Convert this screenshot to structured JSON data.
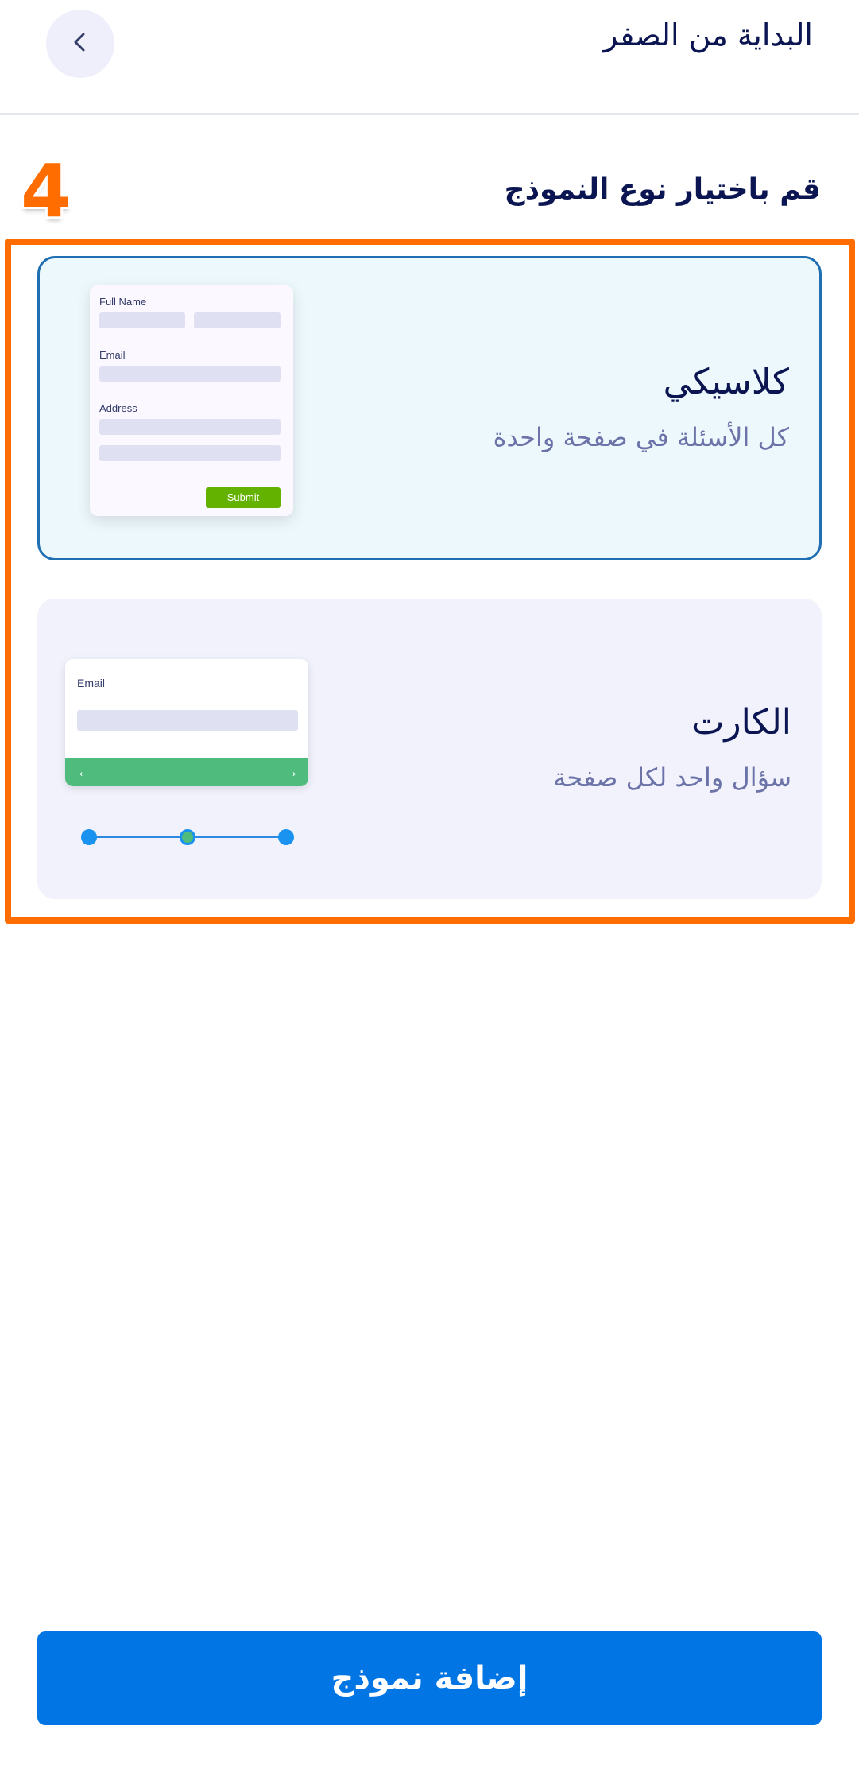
{
  "header": {
    "title": "البداية من الصفر",
    "back_icon": "chevron-left-icon"
  },
  "step_badge": "4",
  "section": {
    "heading": "قم باختيار نوع النموذج"
  },
  "options": [
    {
      "title": "كلاسيكي",
      "description": "كل الأسئلة في صفحة واحدة",
      "selected": true,
      "preview": {
        "full_name_label": "Full Name",
        "email_label": "Email",
        "address_label": "Address",
        "submit_label": "Submit"
      }
    },
    {
      "title": "الكارت",
      "description": "سؤال واحد لكل صفحة",
      "selected": false,
      "preview": {
        "email_label": "Email",
        "prev_arrow": "←",
        "next_arrow": "→"
      }
    }
  ],
  "primary_button": {
    "label": "إضافة نموذج"
  },
  "colors": {
    "highlight": "#ff6d00",
    "primary": "#0075e3",
    "selected_border": "#1f6fb2",
    "submit_green": "#64b200",
    "card_bar_green": "#4fbc7d"
  }
}
